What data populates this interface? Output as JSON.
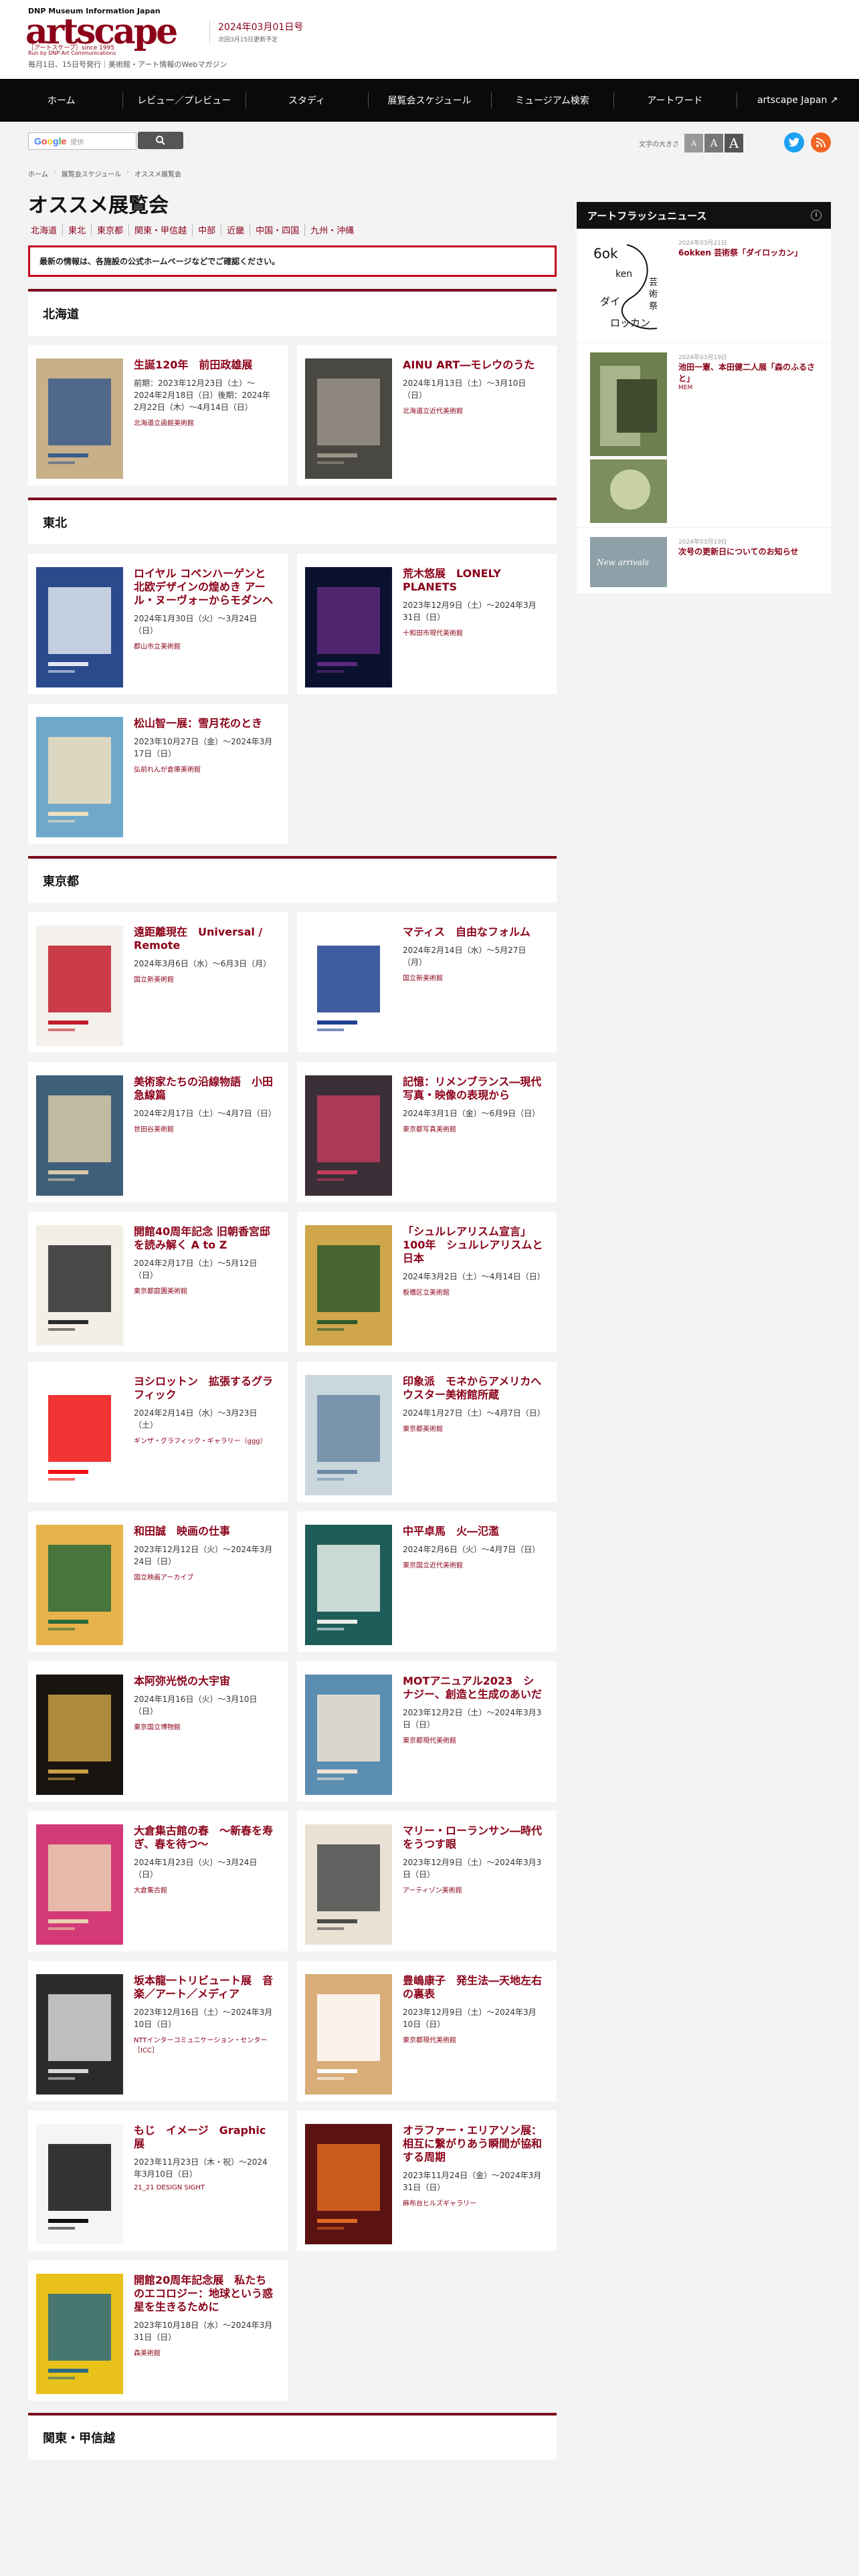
{
  "header": {
    "brand_top": "DNP Museum Information Japan",
    "logo": "artscape",
    "logo_sub": "［アートスケープ］since 1995",
    "logo_run": "Run by DNP Art Communications",
    "issue_date": "2024年03月01日号",
    "next_issue": "次回3月15日更新予定",
    "tagline": "毎月1日、15日号発行｜美術館・アート情報のWebマガジン"
  },
  "nav": [
    "ホーム",
    "レビュー／プレビュー",
    "スタディ",
    "展覧会スケジュール",
    "ミュージアム検索",
    "アートワード",
    "artscape Japan ↗"
  ],
  "search": {
    "google": "Google",
    "placeholder": "提供"
  },
  "font_size": {
    "label": "文字の大きさ",
    "small": "A",
    "medium": "A",
    "large": "A"
  },
  "breadcrumb": [
    "ホーム",
    "展覧会スケジュール",
    "オススメ展覧会"
  ],
  "page": {
    "title": "オススメ展覧会",
    "regions": [
      "北海道",
      "東北",
      "東京都",
      "関東・甲信越",
      "中部",
      "近畿",
      "中国・四国",
      "九州・沖縄"
    ],
    "notice": "最新の情報は、各施設の公式ホームページなどでご確認ください。"
  },
  "sections": [
    {
      "name": "北海道",
      "cards": [
        {
          "title": "生誕120年　前田政雄展",
          "date": "前期：2023年12月23日（土）〜2024年2月18日（日）後期：2024年2月22日（木）〜4月14日（日）",
          "venue": "北海道立函館美術館"
        },
        {
          "title": "AINU ART―モレウのうた",
          "date": "2024年1月13日（土）〜3月10日（日）",
          "venue": "北海道立近代美術館"
        }
      ]
    },
    {
      "name": "東北",
      "cards": [
        {
          "title": "ロイヤル コペンハーゲンと北欧デザインの煌めき アール・ヌーヴォーからモダンへ",
          "date": "2024年1月30日（火）〜3月24日（日）",
          "venue": "郡山市立美術館"
        },
        {
          "title": "荒木悠展　LONELY PLANETS",
          "date": "2023年12月9日（土）〜2024年3月31日（日）",
          "venue": "十和田市現代美術館"
        },
        {
          "title": "松山智一展：雪月花のとき",
          "date": "2023年10月27日（金）〜2024年3月17日（日）",
          "venue": "弘前れんが倉庫美術館"
        }
      ]
    },
    {
      "name": "東京都",
      "cards": [
        {
          "title": "遠距離現在　Universal / Remote",
          "date": "2024年3月6日（水）〜6月3日（月）",
          "venue": "国立新美術館"
        },
        {
          "title": "マティス　自由なフォルム",
          "date": "2024年2月14日（水）〜5月27日（月）",
          "venue": "国立新美術館"
        },
        {
          "title": "美術家たちの沿線物語　小田急線篇",
          "date": "2024年2月17日（土）〜4月7日（日）",
          "venue": "世田谷美術館"
        },
        {
          "title": "記憶：リメンブランス―現代写真・映像の表現から",
          "date": "2024年3月1日（金）〜6月9日（日）",
          "venue": "東京都写真美術館"
        },
        {
          "title": "開館40周年記念 旧朝香宮邸を読み解く A to Z",
          "date": "2024年2月17日（土）〜5月12日（日）",
          "venue": "東京都庭園美術館"
        },
        {
          "title": "「シュルレアリスム宣言」100年　シュルレアリスムと日本",
          "date": "2024年3月2日（土）〜4月14日（日）",
          "venue": "板橋区立美術館"
        },
        {
          "title": "ヨシロットン　拡張するグラフィック",
          "date": "2024年2月14日（水）〜3月23日（土）",
          "venue": "ギンザ・グラフィック・ギャラリー（ggg）"
        },
        {
          "title": "印象派　モネからアメリカへ　ウスター美術館所蔵",
          "date": "2024年1月27日（土）〜4月7日（日）",
          "venue": "東京都美術館"
        },
        {
          "title": "和田誠　映画の仕事",
          "date": "2023年12月12日（火）〜2024年3月24日（日）",
          "venue": "国立映画アーカイブ"
        },
        {
          "title": "中平卓馬　火―氾濫",
          "date": "2024年2月6日（火）〜4月7日（日）",
          "venue": "東京国立近代美術館"
        },
        {
          "title": "本阿弥光悦の大宇宙",
          "date": "2024年1月16日（火）〜3月10日（日）",
          "venue": "東京国立博物館"
        },
        {
          "title": "MOTアニュアル2023　シナジー、創造と生成のあいだ",
          "date": "2023年12月2日（土）〜2024年3月3日（日）",
          "venue": "東京都現代美術館"
        },
        {
          "title": "大倉集古館の春　〜新春を寿ぎ、春を待つ〜",
          "date": "2024年1月23日（火）〜3月24日（日）",
          "venue": "大倉集古館"
        },
        {
          "title": "マリー・ローランサン―時代をうつす眼",
          "date": "2023年12月9日（土）〜2024年3月3日（日）",
          "venue": "アーティゾン美術館"
        },
        {
          "title": "坂本龍一トリビュート展　音楽／アート／メディア",
          "date": "2023年12月16日（土）〜2024年3月10日（日）",
          "venue": "NTTインターコミュニケーション・センター［ICC］"
        },
        {
          "title": "豊嶋康子　発生法―天地左右の裏表",
          "date": "2023年12月9日（土）〜2024年3月10日（日）",
          "venue": "東京都現代美術館"
        },
        {
          "title": "もじ　イメージ　Graphic 展",
          "date": "2023年11月23日（木・祝）〜2024年3月10日（日）",
          "venue": "21_21 DESIGN SIGHT"
        },
        {
          "title": "オラファー・エリアソン展：相互に繋がりあう瞬間が協和する周期",
          "date": "2023年11月24日（金）〜2024年3月31日（日）",
          "venue": "麻布台ヒルズギャラリー"
        },
        {
          "title": "開館20周年記念展　私たちのエコロジー：地球という惑星を生きるために",
          "date": "2023年10月18日（水）〜2024年3月31日（日）",
          "venue": "森美術館"
        }
      ]
    },
    {
      "name": "関東・甲信越",
      "cards": []
    }
  ],
  "sidebar": {
    "title": "アートフラッシュニュース",
    "items": [
      {
        "date": "2024年03月21日",
        "title": "6okken 芸術祭「ダイロッカン」",
        "sub": ""
      },
      {
        "date": "2024年03月19日",
        "title": "池田一憲、本田健二人展「森のふるさと」",
        "sub": "MEM"
      },
      {
        "date": "2024年03月19日",
        "title": "次号の更新日についてのお知らせ",
        "sub": ""
      }
    ]
  },
  "colors": {
    "accent": "#8b0018",
    "nav_bg": "#0a0a0a",
    "notice_border": "#c8001e"
  }
}
